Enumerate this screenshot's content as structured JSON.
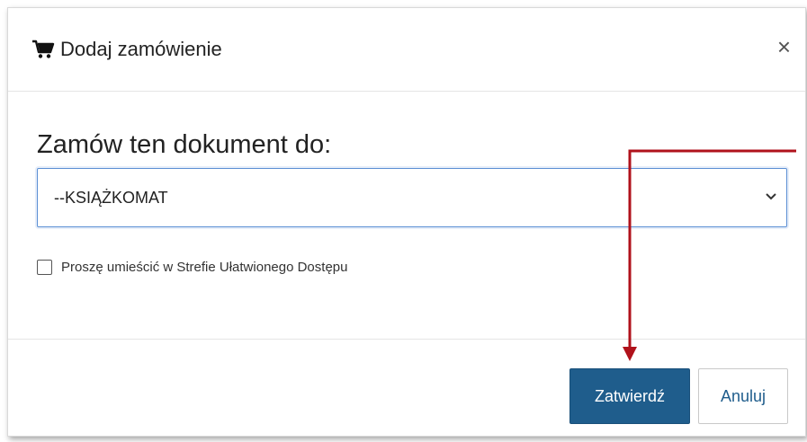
{
  "dialog": {
    "title": "Dodaj zamówienie",
    "close_label": "×"
  },
  "form": {
    "heading": "Zamów ten dokument do:",
    "select_value": "--KSIĄŻKOMAT",
    "checkbox_label": "Proszę umieścić w Strefie Ułatwionego Dostępu",
    "checkbox_checked": false
  },
  "buttons": {
    "confirm_label": "Zatwierdź",
    "cancel_label": "Anuluj"
  },
  "colors": {
    "primary": "#1f5d8c",
    "annotation_arrow": "#b0121b",
    "select_focus_border": "#5b8fd4"
  },
  "icons": {
    "title_icon": "shopping-cart-icon",
    "close_icon": "close-icon",
    "select_icon": "chevron-down-icon"
  }
}
